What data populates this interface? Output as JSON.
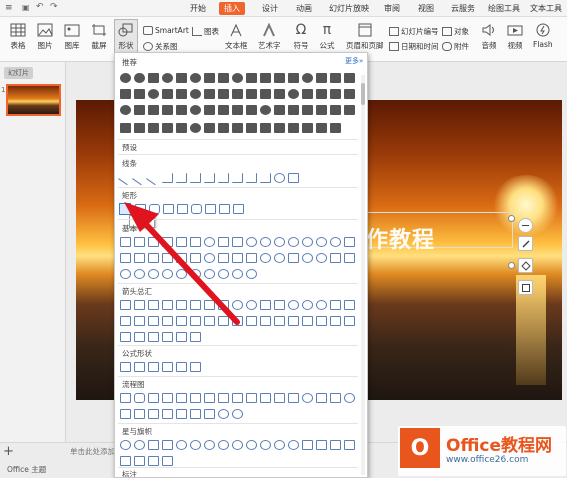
{
  "menubar": {
    "items": [
      "开始",
      "插入",
      "设计",
      "动画",
      "幻灯片放映",
      "审阅",
      "视图",
      "云服务",
      "绘图工具",
      "文本工具"
    ],
    "active": "插入"
  },
  "toolbar": {
    "table": "表格",
    "picture": "图片",
    "gallery": "图库",
    "screenshot": "截屏",
    "shape": "形状",
    "smartart": "SmartArt",
    "chart": "图表",
    "relation": "关系图",
    "textbox": "文本框",
    "wordart": "艺术字",
    "symbol": "符号",
    "formula": "公式",
    "headerfooter": "页眉和页脚",
    "slidenum": "幻灯片编号",
    "object": "对象",
    "datetime": "日期和时间",
    "attach": "附件",
    "audio": "音频",
    "video": "视频",
    "flash": "Flash"
  },
  "leftpane": {
    "tab": "幻灯片",
    "thumb_number": "1",
    "add": "+"
  },
  "slide": {
    "text": "作教程"
  },
  "panel": {
    "recommended": "推荐",
    "more": "更多»",
    "preset": "预设",
    "lines": "线条",
    "rect": "矩形",
    "basic": "基本",
    "arrows": "箭头总汇",
    "equation": "公式形状",
    "flowchart": "流程图",
    "stars": "星与旗帜",
    "callouts": "标注"
  },
  "status": {
    "notes": "单击此处添加备注",
    "theme": "Office 主题"
  },
  "watermark": {
    "icon_letter": "O",
    "brand": "Office教程网",
    "url": "www.office26.com"
  },
  "colors": {
    "accent": "#f0642d",
    "shape_outline": "#5c7fb5",
    "arrow": "#e0141e",
    "logo": "#e8561e"
  }
}
